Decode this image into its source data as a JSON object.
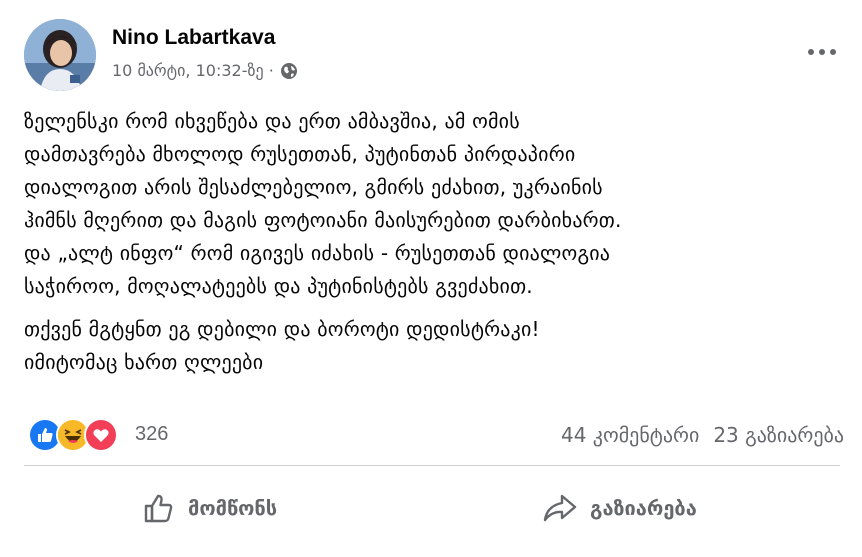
{
  "post": {
    "author": "Nino Labartkava",
    "timestamp": "10 მარტი, 10:32-ზე ·",
    "privacy_icon": "globe-icon",
    "body_lines": [
      "ზელენსკი რომ იხვეწება და ერთ ამბავშია, ამ ომის",
      "დამთავრება მხოლოდ რუსეთთან, პუტინთან პირდაპირი",
      "დიალოგით არის შესაძლებელიო, გმირს ეძახით, უკრაინის",
      "ჰიმნს მღერით და მაგის ფოტოიანი მაისურებით დარბიხართ.",
      "და „ალტ ინფო“ რომ იგივეს იძახის - რუსეთთან დიალოგია",
      "საჭიროო, მოღალატეებს და პუტინისტებს გვეძახით."
    ],
    "body_lines_2": [
      "თქვენ მგტყნთ ეგ დებილი და ბოროტი დედისტრაკი!",
      "იმიტომაც ხართ ღლეები"
    ]
  },
  "stats": {
    "reaction_count": "326",
    "reactions": [
      "like",
      "haha",
      "love"
    ],
    "comments": "44 კომენტარი",
    "shares": "23 გაზიარება"
  },
  "actions": {
    "like_label": "მომწონს",
    "share_label": "გაზიარება"
  },
  "colors": {
    "like_blue": "#1877f2",
    "haha_yellow": "#f7b928",
    "love_red": "#f33e58",
    "secondary_text": "#65676b"
  }
}
